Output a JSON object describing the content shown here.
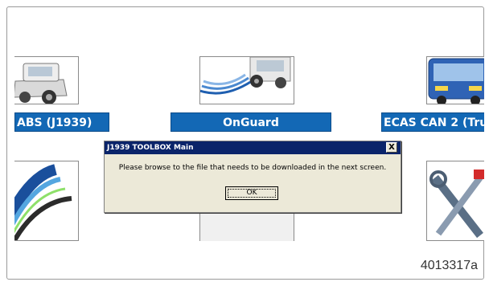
{
  "tiles": [
    {
      "label": "ABS (J1939)",
      "icon": "truck-icon"
    },
    {
      "label": "OnGuard",
      "icon": "onguard-radar-truck-icon"
    },
    {
      "label": "ECAS CAN 2 (Tru",
      "icon": "bus-icon"
    }
  ],
  "lower_tiles": [
    {
      "icon": "rainbow-arc-icon"
    },
    {
      "icon": "blank-tile-icon"
    },
    {
      "icon": "tools-icon"
    }
  ],
  "dialog": {
    "title": "J1939 TOOLBOX Main",
    "close": "X",
    "message": "Please browse to the file that needs to be downloaded in the next screen.",
    "ok_label": "OK"
  },
  "figure_id": "4013317a",
  "colors": {
    "label_bg": "#1368b5",
    "titlebar": "#0a246a",
    "dialog_bg": "#ece9d8"
  }
}
